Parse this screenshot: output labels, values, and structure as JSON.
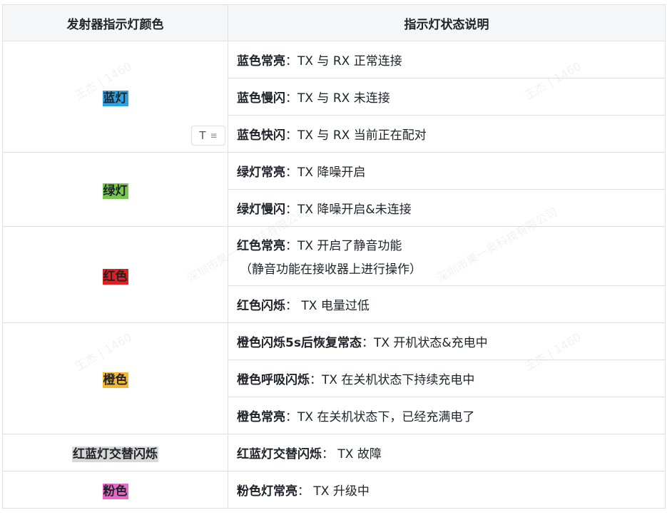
{
  "table": {
    "headers": [
      "发射器指示灯颜色",
      "指示灯状态说明"
    ],
    "groups": [
      {
        "color_label": "蓝灯",
        "highlight": "#2ea3e3",
        "rows": [
          {
            "key": "蓝色常亮",
            "sep": "：",
            "text": "TX 与 RX 正常连接"
          },
          {
            "key": "蓝色慢闪",
            "sep": "：",
            "text": "TX 与 RX 未连接"
          },
          {
            "key": "蓝色快闪",
            "sep": "：",
            "text": "TX 与 RX 当前正在配对"
          }
        ]
      },
      {
        "color_label": "绿灯",
        "highlight": "#78c850",
        "rows": [
          {
            "key": "绿灯常亮",
            "sep": "：",
            "text": "TX 降噪开启"
          },
          {
            "key": "绿灯慢闪",
            "sep": "：",
            "text": "TX 降噪开启&未连接"
          }
        ]
      },
      {
        "color_label": "红色",
        "highlight": "#e02020",
        "rows": [
          {
            "key": "红色常亮",
            "sep": "：",
            "text": "TX 开启了静音功能",
            "line2": "（静音功能在接收器上进行操作）"
          },
          {
            "key": "红色闪烁",
            "sep": "：",
            "text": " TX 电量过低"
          }
        ]
      },
      {
        "color_label": "橙色",
        "highlight": "#f5b731",
        "rows": [
          {
            "key": "橙色闪烁5s后恢复常态",
            "sep": "：",
            "text": "TX 开机状态&充电中"
          },
          {
            "key": "橙色呼吸闪烁",
            "sep": "：",
            "text": "TX 在关机状态下持续充电中"
          },
          {
            "key": "橙色常亮",
            "sep": "：",
            "text": "TX 在关机状态下，已经充满电了"
          }
        ]
      },
      {
        "color_label": "红蓝灯交替闪烁",
        "highlight": "#d8d8d8",
        "rows": [
          {
            "key": "红蓝灯交替闪烁",
            "sep": "：",
            "text": " TX 故障"
          }
        ]
      },
      {
        "color_label": "粉色",
        "highlight": "#e868c8",
        "rows": [
          {
            "key": "粉色灯常亮",
            "sep": "：",
            "text": " TX 升级中"
          }
        ]
      }
    ]
  },
  "toolbar": {
    "text_icon": "T",
    "menu_icon": "≡"
  },
  "watermark": {
    "text": "王杰 | 1460",
    "company": "深圳市果一奥科技有限公司"
  }
}
